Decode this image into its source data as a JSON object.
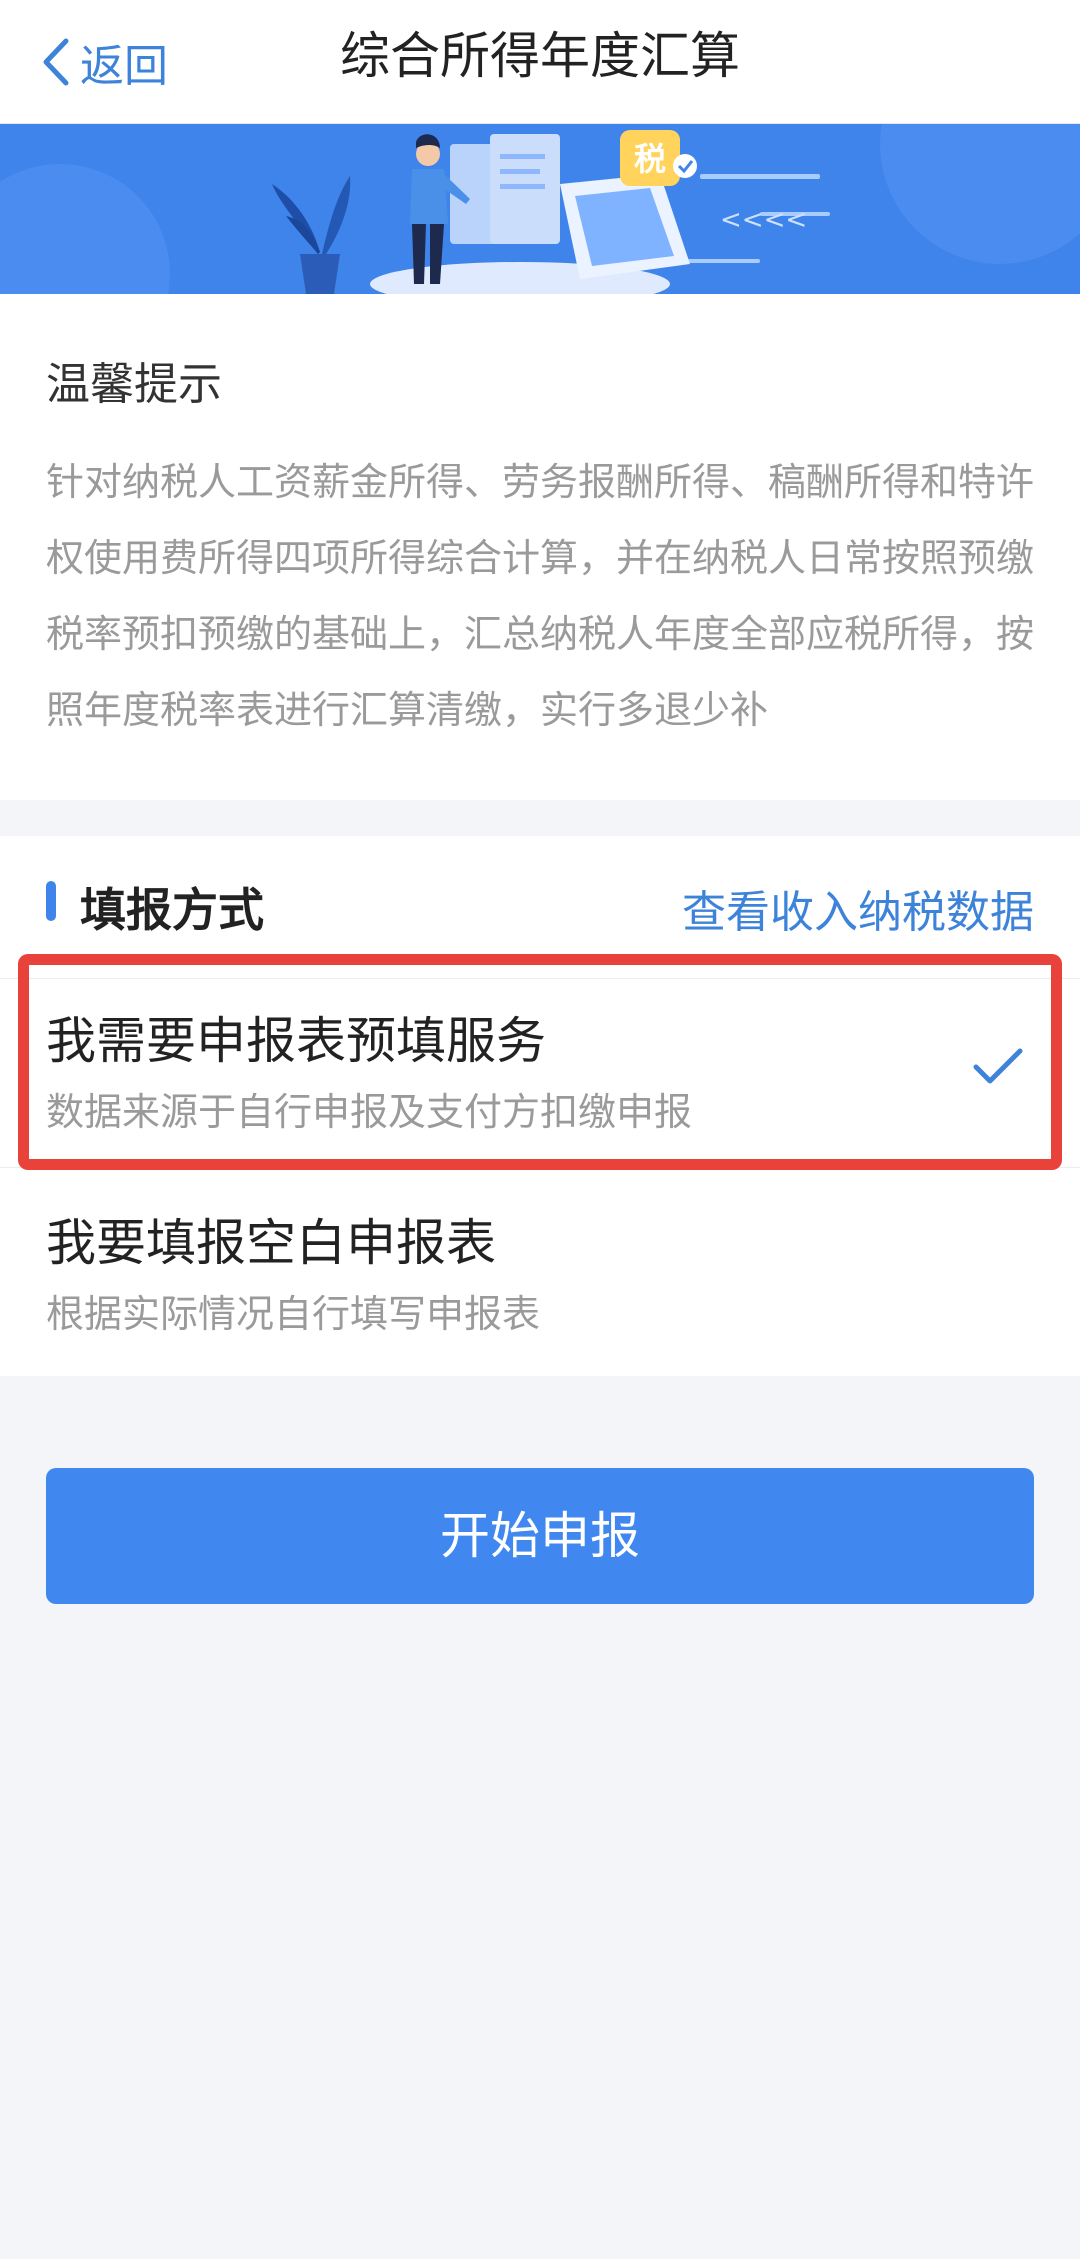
{
  "navbar": {
    "back_label": "返回",
    "title": "综合所得年度汇算"
  },
  "banner": {
    "badge_text": "税",
    "arrows_text": "<<<<"
  },
  "tips": {
    "title": "温馨提示",
    "body": "针对纳税人工资薪金所得、劳务报酬所得、稿酬所得和特许权使用费所得四项所得综合计算，并在纳税人日常按照预缴税率预扣预缴的基础上，汇总纳税人年度全部应税所得，按照年度税率表进行汇算清缴，实行多退少补"
  },
  "method": {
    "title": "填报方式",
    "link_label": "查看收入纳税数据",
    "options": [
      {
        "title": "我需要申报表预填服务",
        "subtitle": "数据来源于自行申报及支付方扣缴申报",
        "selected": true
      },
      {
        "title": "我要填报空白申报表",
        "subtitle": "根据实际情况自行填写申报表",
        "selected": false
      }
    ]
  },
  "submit": {
    "label": "开始申报"
  },
  "colors": {
    "accent": "#3f84ea",
    "highlight": "#e8423b",
    "background": "#f3f5f9"
  }
}
